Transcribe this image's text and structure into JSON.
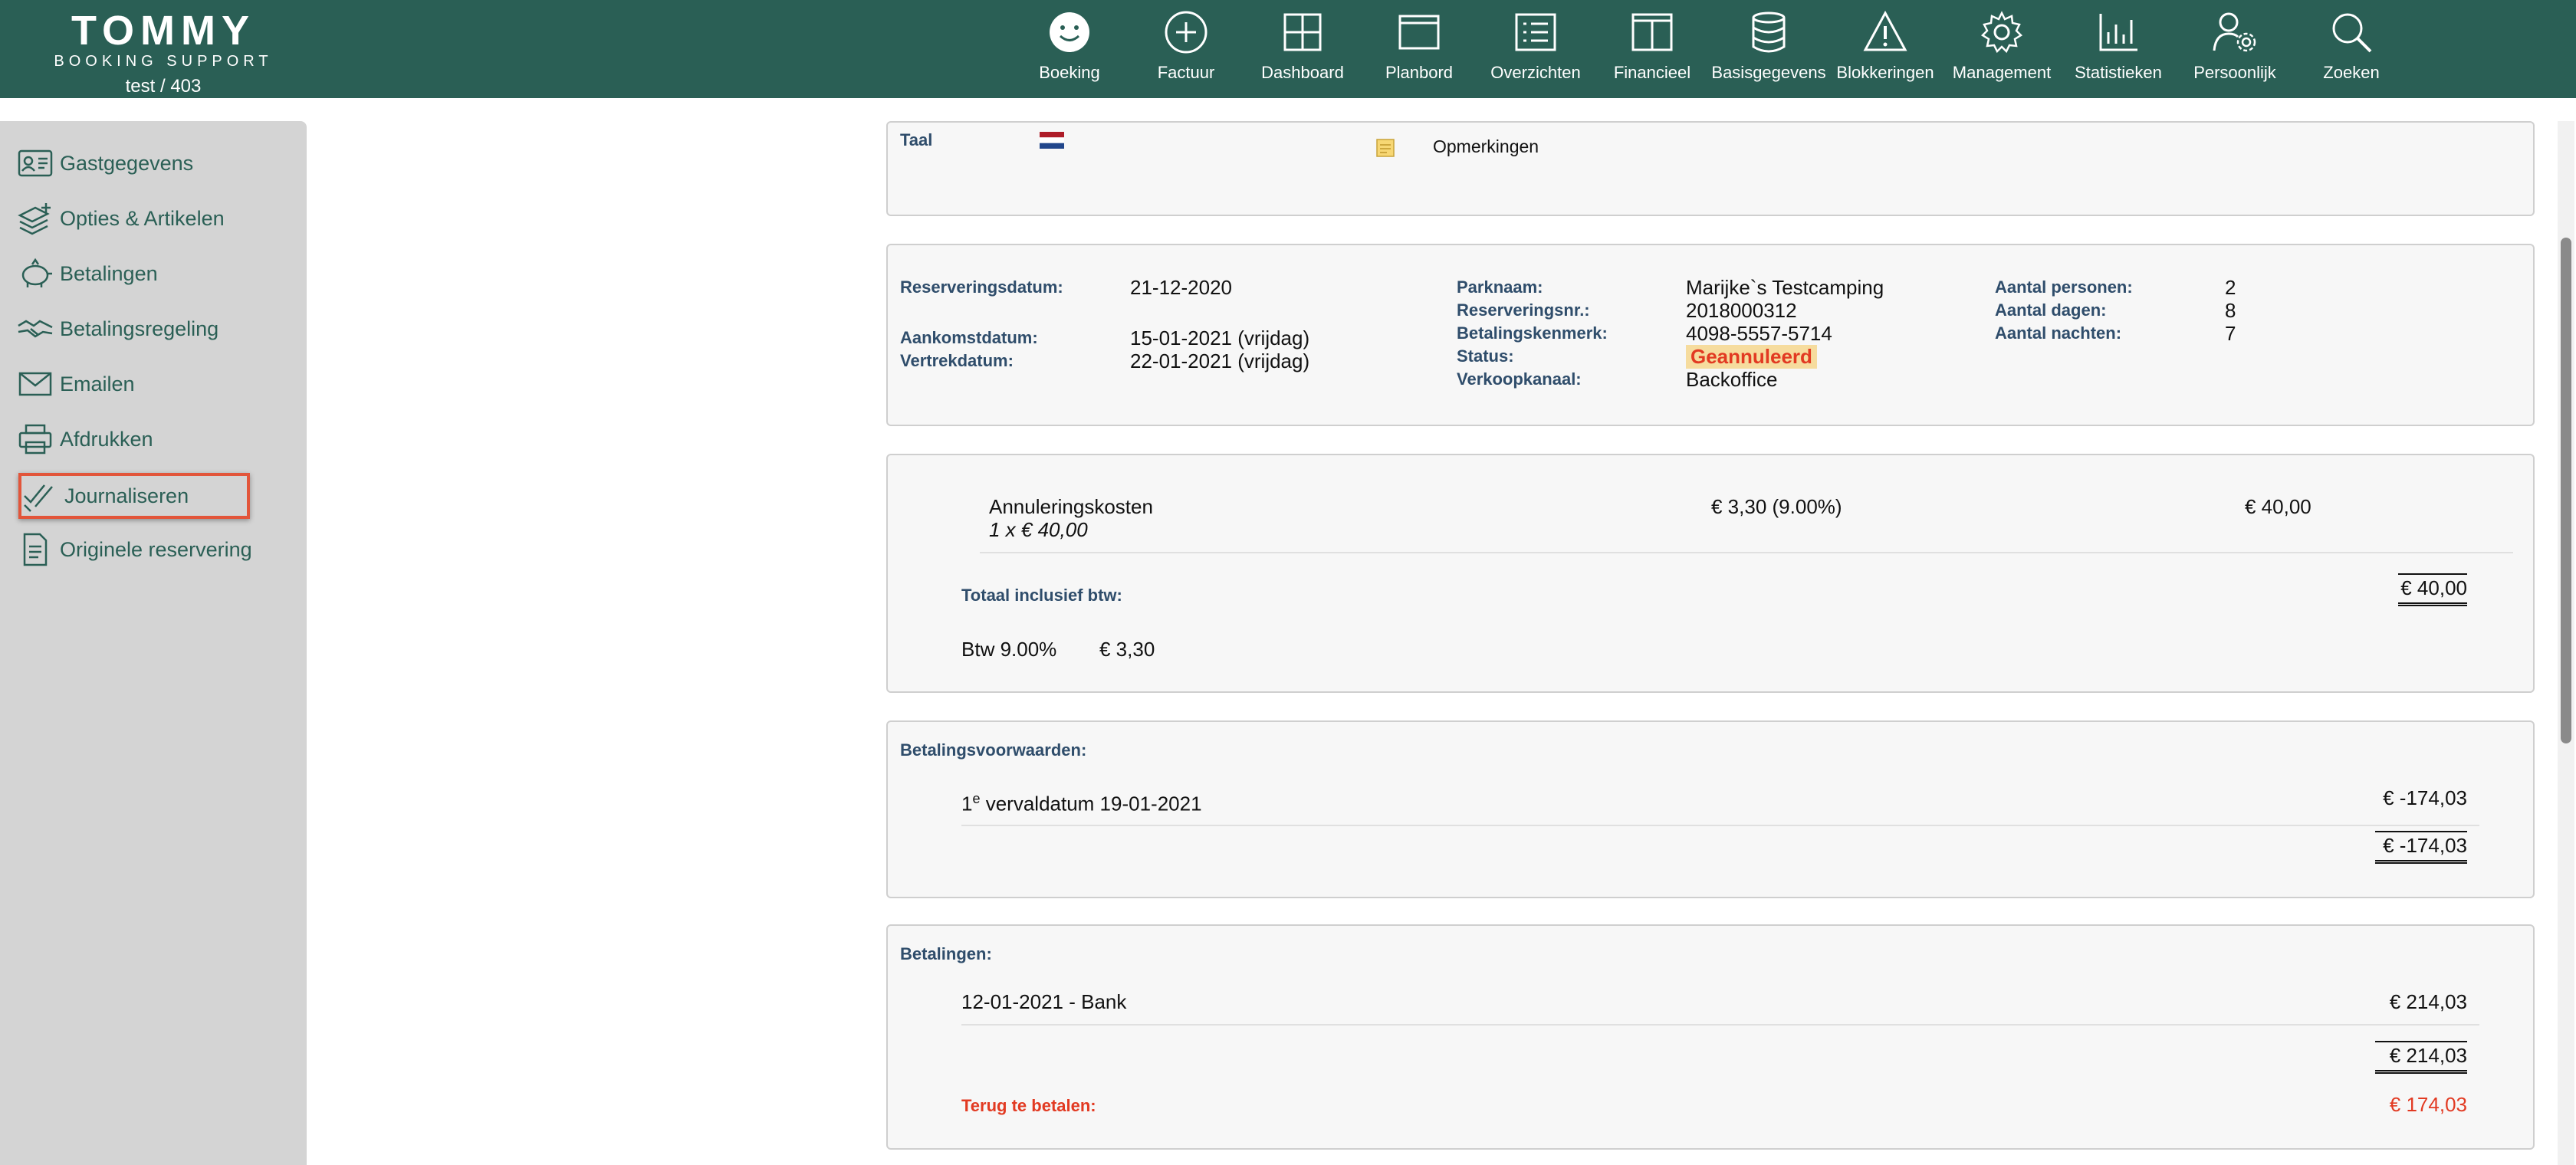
{
  "header": {
    "logo_main": "TOMMY",
    "logo_sub": "BOOKING SUPPORT",
    "user": "test / 403",
    "nav": [
      {
        "label": "Boeking",
        "icon": "smiley-icon"
      },
      {
        "label": "Factuur",
        "icon": "plus-circle-icon"
      },
      {
        "label": "Dashboard",
        "icon": "grid-icon"
      },
      {
        "label": "Planbord",
        "icon": "window-icon"
      },
      {
        "label": "Overzichten",
        "icon": "list-icon"
      },
      {
        "label": "Financieel",
        "icon": "columns-icon"
      },
      {
        "label": "Basisgegevens",
        "icon": "database-icon"
      },
      {
        "label": "Blokkeringen",
        "icon": "warning-icon"
      },
      {
        "label": "Management",
        "icon": "gear-icon"
      },
      {
        "label": "Statistieken",
        "icon": "bar-chart-icon"
      },
      {
        "label": "Persoonlijk",
        "icon": "user-gear-icon"
      },
      {
        "label": "Zoeken",
        "icon": "search-icon"
      }
    ]
  },
  "sidebar": {
    "items": [
      {
        "label": "Gastgegevens",
        "icon": "id-card-icon"
      },
      {
        "label": "Opties & Artikelen",
        "icon": "layers-plus-icon"
      },
      {
        "label": "Betalingen",
        "icon": "piggy-bank-icon"
      },
      {
        "label": "Betalingsregeling",
        "icon": "handshake-icon"
      },
      {
        "label": "Emailen",
        "icon": "envelope-icon"
      },
      {
        "label": "Afdrukken",
        "icon": "printer-icon"
      },
      {
        "label": "Journaliseren",
        "icon": "double-check-icon",
        "active": true
      },
      {
        "label": "Originele reservering",
        "icon": "document-icon"
      }
    ]
  },
  "lang_panel": {
    "taal_label": "Taal",
    "flag_icon": "dutch-flag-icon",
    "note_icon": "note-icon",
    "opmerkingen": "Opmerkingen"
  },
  "reservation": {
    "reserveringsdatum_label": "Reserveringsdatum:",
    "reserveringsdatum": "21-12-2020",
    "aankomstdatum_label": "Aankomstdatum:",
    "aankomstdatum": "15-01-2021 (vrijdag)",
    "vertrekdatum_label": "Vertrekdatum:",
    "vertrekdatum": "22-01-2021 (vrijdag)",
    "parknaam_label": "Parknaam:",
    "parknaam": "Marijke`s Testcamping",
    "reserveringsnr_label": "Reserveringsnr.:",
    "reserveringsnr": "2018000312",
    "betalingskenmerk_label": "Betalingskenmerk:",
    "betalingskenmerk": "4098-5557-5714",
    "status_label": "Status:",
    "status": "Geannuleerd",
    "verkoopkanaal_label": "Verkoopkanaal:",
    "verkoopkanaal": "Backoffice",
    "personen_label": "Aantal personen:",
    "personen": "2",
    "dagen_label": "Aantal dagen:",
    "dagen": "8",
    "nachten_label": "Aantal nachten:",
    "nachten": "7"
  },
  "costs": {
    "item_name": "Annuleringskosten",
    "item_qty": "1 x € 40,00",
    "item_vat": "€ 3,30 (9.00%)",
    "item_amount": "€ 40,00",
    "total_label": "Totaal inclusief btw:",
    "total": "€ 40,00",
    "btw_label": "Btw 9.00%",
    "btw_value": "€ 3,30"
  },
  "conditions": {
    "title": "Betalingsvoorwaarden:",
    "row_prefix": "1",
    "row_sup": "e",
    "row_text": " vervaldatum 19-01-2021",
    "row_amount": "€ -174,03",
    "total": "€ -174,03"
  },
  "payments": {
    "title": "Betalingen:",
    "row_text": "12-01-2021 - Bank",
    "row_amount": "€ 214,03",
    "total": "€ 214,03",
    "refund_label": "Terug te betalen:",
    "refund_amount": "€ 174,03"
  }
}
